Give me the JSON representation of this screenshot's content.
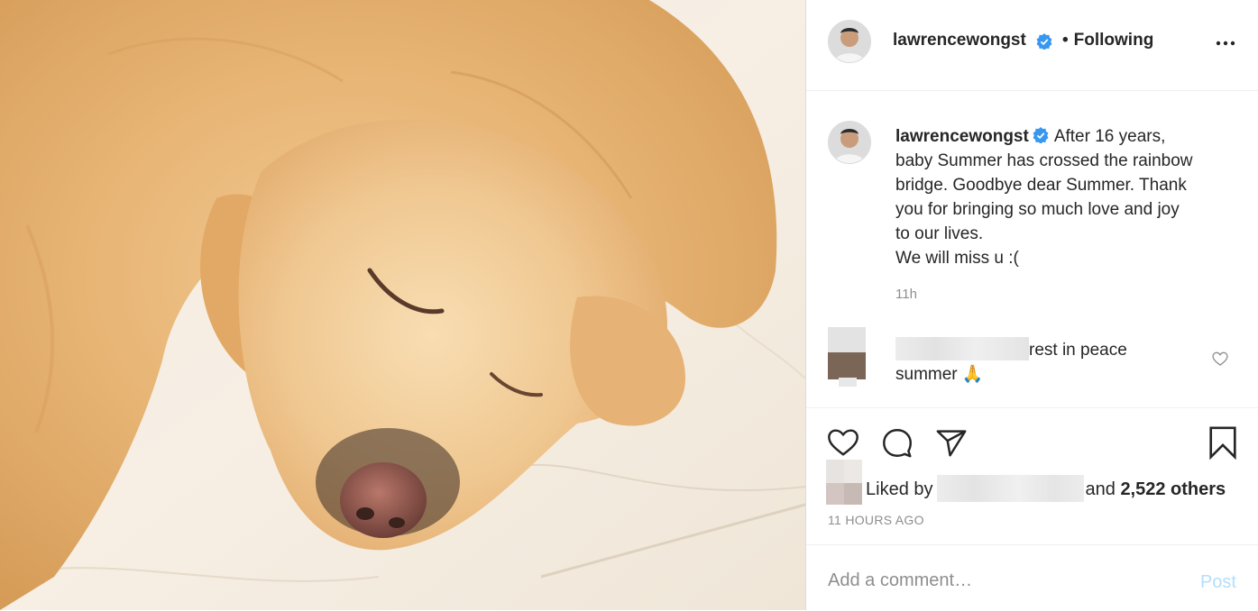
{
  "post": {
    "username": "lawrencewongst",
    "separator": "•",
    "follow_label": "Following",
    "more_icon": "more-horizontal-icon",
    "caption_lines": [
      "After 16 years,",
      "baby Summer has crossed the rainbow",
      "bridge. Goodbye dear Summer. Thank",
      "you for bringing so much love and joy",
      "to our lives."
    ],
    "caption_line_last": "We will miss u :(",
    "caption_time": "11h"
  },
  "comment": {
    "text_part1": "rest in peace",
    "text_part2": "summer",
    "emoji": "🙏",
    "like_icon": "heart-outline-icon"
  },
  "actions": {
    "like_icon": "heart-icon",
    "comment_icon": "comment-bubble-icon",
    "share_icon": "paper-plane-icon",
    "save_icon": "bookmark-icon"
  },
  "likes": {
    "prefix": "Liked by",
    "conjunction": "and",
    "count_label": "2,522 others"
  },
  "timestamp": "11 HOURS AGO",
  "add_comment": {
    "placeholder": "Add a comment…",
    "post_label": "Post"
  },
  "colors": {
    "verified_blue": "#3897f0",
    "post_button_disabled": "#b2dffc",
    "secondary_text": "#8e8e8e",
    "dog_fur": "#e9b779"
  }
}
